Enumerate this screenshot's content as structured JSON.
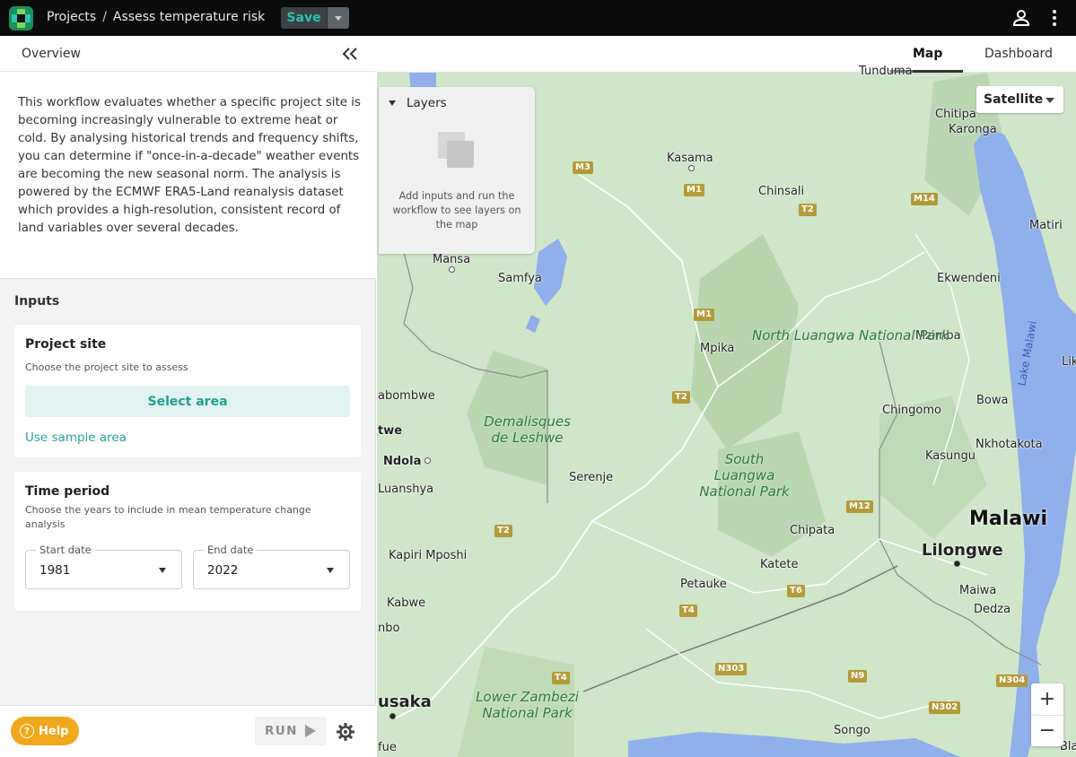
{
  "header": {
    "breadcrumb_root": "Projects",
    "breadcrumb_sep": "/",
    "breadcrumb_current": "Assess temperature risk",
    "save_label": "Save",
    "logo_icon": "app-logo-icon",
    "user_icon": "user-icon",
    "menu_icon": "kebab-menu-icon"
  },
  "sidebar": {
    "overview_label": "Overview",
    "description": "This workflow evaluates whether a specific project site is becoming increasingly vulnerable to extreme heat or cold. By analysing historical trends and frequency shifts, you can determine if \"once-in-a-decade\" weather events are becoming the new seasonal norm. The analysis is powered by the ECMWF ERA5-Land reanalysis dataset which provides a high-resolution, consistent record of land variables over several decades.",
    "inputs_title": "Inputs",
    "project_site": {
      "title": "Project site",
      "subtitle": "Choose the project site to assess",
      "select_label": "Select area",
      "sample_label": "Use sample area"
    },
    "time_period": {
      "title": "Time period",
      "subtitle": "Choose the years to include in mean temperature change analysis",
      "start_label": "Start date",
      "start_value": "1981",
      "end_label": "End date",
      "end_value": "2022"
    },
    "help_label": "Help",
    "run_label": "RUN"
  },
  "main": {
    "tabs": [
      {
        "label": "Map",
        "active": true
      },
      {
        "label": "Dashboard",
        "active": false
      }
    ],
    "layers_title": "Layers",
    "layers_message": "Add inputs and run the workflow to see layers on the map",
    "basemap_selected": "Satellite",
    "zoom_in": "+",
    "zoom_out": "−"
  },
  "map_labels": {
    "places": [
      "Tunduma",
      "Chitipa",
      "Karonga",
      "Kasama",
      "Chinsali",
      "Mansa",
      "Samfya",
      "Matiri",
      "Ekwendeni",
      "Mzimba",
      "Mpika",
      "abombwe",
      "Bowa",
      "Chingomo",
      "twe",
      "Nkhotakota",
      "Ndola",
      "Luanshya",
      "Kasungu",
      "Serenje",
      "Chipata",
      "Lilongwe",
      "Kapiri Mposhi",
      "Katete",
      "Maiwa",
      "Petauke",
      "Dedza",
      "Kabwe",
      "nbo",
      "usaka",
      "Songo",
      "fue",
      "Lik",
      "Bla"
    ],
    "parks": [
      "North Luangwa National Park",
      "South Luangwa National Park",
      "Lower Zambezi National Park"
    ],
    "demalisques": "Demalisques de Leshwe",
    "country": "Malawi",
    "lake": "Lake Malawi",
    "roads": [
      "M3",
      "M1",
      "T2",
      "M14",
      "M1",
      "T2",
      "M12",
      "T2",
      "T6",
      "T4",
      "T4",
      "N303",
      "N9",
      "N304",
      "N302"
    ]
  },
  "colors": {
    "topbar_bg": "#0b0b0c",
    "accent_teal": "#27a69b",
    "help_orange": "#f2a81d",
    "map_land": "#cfe6c9",
    "lake_blue": "#8fb0ea"
  }
}
